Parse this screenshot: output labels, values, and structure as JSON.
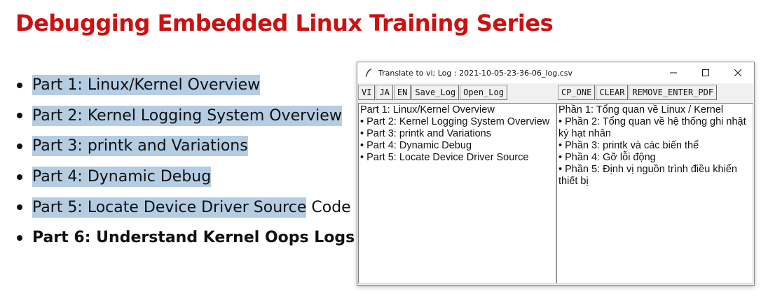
{
  "slide": {
    "title": "Debugging Embedded Linux Training Series",
    "bullets": [
      {
        "text": "Part 1: Linux/Kernel Overview",
        "extra": ""
      },
      {
        "text": "Part 2: Kernel Logging System Overview",
        "extra": ""
      },
      {
        "text": "Part 3: printk and Variations",
        "extra": ""
      },
      {
        "text": "Part 4: Dynamic Debug",
        "extra": ""
      },
      {
        "text": "Part 5: Locate Device Driver Source",
        "extra": " Code"
      },
      {
        "text": "Part 6: Understand Kernel Oops Logs",
        "extra": ""
      }
    ]
  },
  "window": {
    "title": "Translate to vi; Log : 2021-10-05-23-36-06_log.csv",
    "icon": "feather-icon",
    "controls": [
      "minimize-icon",
      "maximize-icon",
      "close-icon"
    ],
    "toolbar_left": [
      "VI",
      "JA",
      "EN",
      "Save_Log",
      "Open_Log"
    ],
    "toolbar_right": [
      "CP_ONE",
      "CLEAR",
      "REMOVE_ENTER_PDF"
    ],
    "left_pane": [
      "Part 1: Linux/Kernel Overview",
      "• Part 2: Kernel Logging System Overview",
      "• Part 3: printk and Variations",
      "• Part 4: Dynamic Debug",
      "• Part 5: Locate Device Driver Source"
    ],
    "right_pane": [
      "Phần 1: Tổng quan về Linux / Kernel",
      "• Phần 2: Tổng quan về hệ thống ghi nhật ký hạt nhân",
      "• Phần 3: printk và các biến thể",
      "• Phần 4: Gỡ lỗi động",
      "• Phần 5: Định vị nguồn trình điều khiển thiết bị"
    ]
  },
  "colors": {
    "title_red": "#cc1111",
    "highlight_blue": "#b4cde3"
  }
}
